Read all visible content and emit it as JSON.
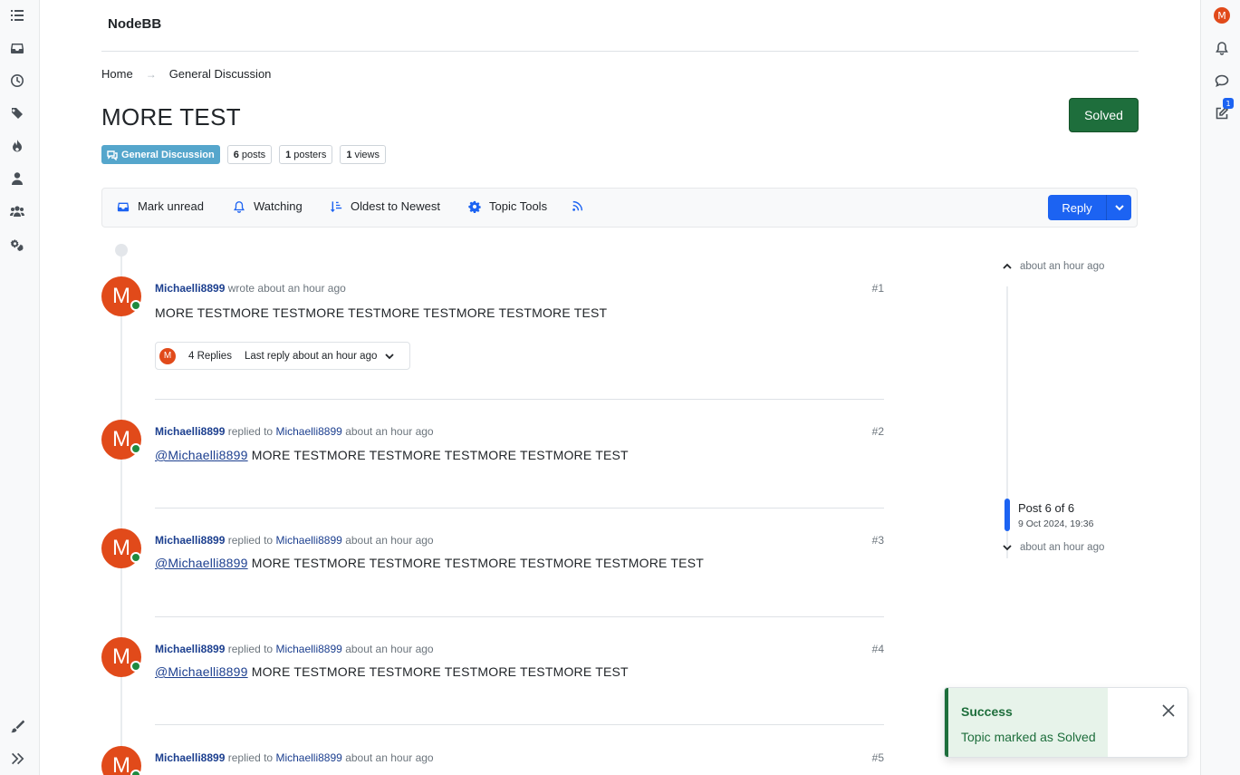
{
  "brand": "NodeBB",
  "breadcrumb": {
    "home": "Home",
    "category": "General Discussion",
    "separator": "→"
  },
  "topic": {
    "title": "MORE TEST",
    "solved_label": "Solved",
    "category_label": "General Discussion",
    "stats": {
      "posts_count": "6",
      "posts_label": "posts",
      "posters_count": "1",
      "posters_label": "posters",
      "views_count": "1",
      "views_label": "views"
    }
  },
  "toolbar": {
    "mark_unread": "Mark unread",
    "watching": "Watching",
    "sort": "Oldest to Newest",
    "topic_tools": "Topic Tools",
    "reply": "Reply"
  },
  "posts": [
    {
      "avatar": "M",
      "user": "Michaelli8899",
      "action": "wrote about an hour ago",
      "num": "#1",
      "content": "MORE TESTMORE TESTMORE TESTMORE TESTMORE TESTMORE TEST",
      "replies": {
        "avatar": "M",
        "count": "4 Replies",
        "last": "Last reply about an hour ago"
      }
    },
    {
      "avatar": "M",
      "user": "Michaelli8899",
      "action": "replied to",
      "target": "Michaelli8899",
      "time": "about an hour ago",
      "num": "#2",
      "mention": "@Michaelli8899",
      "content": "MORE TESTMORE TESTMORE TESTMORE TESTMORE TEST"
    },
    {
      "avatar": "M",
      "user": "Michaelli8899",
      "action": "replied to",
      "target": "Michaelli8899",
      "time": "about an hour ago",
      "num": "#3",
      "mention": "@Michaelli8899",
      "content": "MORE TESTMORE TESTMORE TESTMORE TESTMORE TESTMORE TEST"
    },
    {
      "avatar": "M",
      "user": "Michaelli8899",
      "action": "replied to",
      "target": "Michaelli8899",
      "time": "about an hour ago",
      "num": "#4",
      "mention": "@Michaelli8899",
      "content": "MORE TESTMORE TESTMORE TESTMORE TESTMORE TEST"
    },
    {
      "avatar": "M",
      "user": "Michaelli8899",
      "action": "replied to",
      "target": "Michaelli8899",
      "time": "about an hour ago",
      "num": "#5"
    }
  ],
  "navigator": {
    "top_time": "about an hour ago",
    "position": "Post 6 of 6",
    "date": "9 Oct 2024, 19:36",
    "bottom_time": "about an hour ago"
  },
  "toast": {
    "title": "Success",
    "message": "Topic marked as Solved"
  },
  "right_bar": {
    "user_avatar": "M",
    "drafts_badge": "1"
  },
  "colors": {
    "accent": "#1c63f2",
    "solved": "#1e6e3c",
    "avatar": "#e14a1a",
    "category": "#55a6cc",
    "online": "#1f8a3f"
  }
}
